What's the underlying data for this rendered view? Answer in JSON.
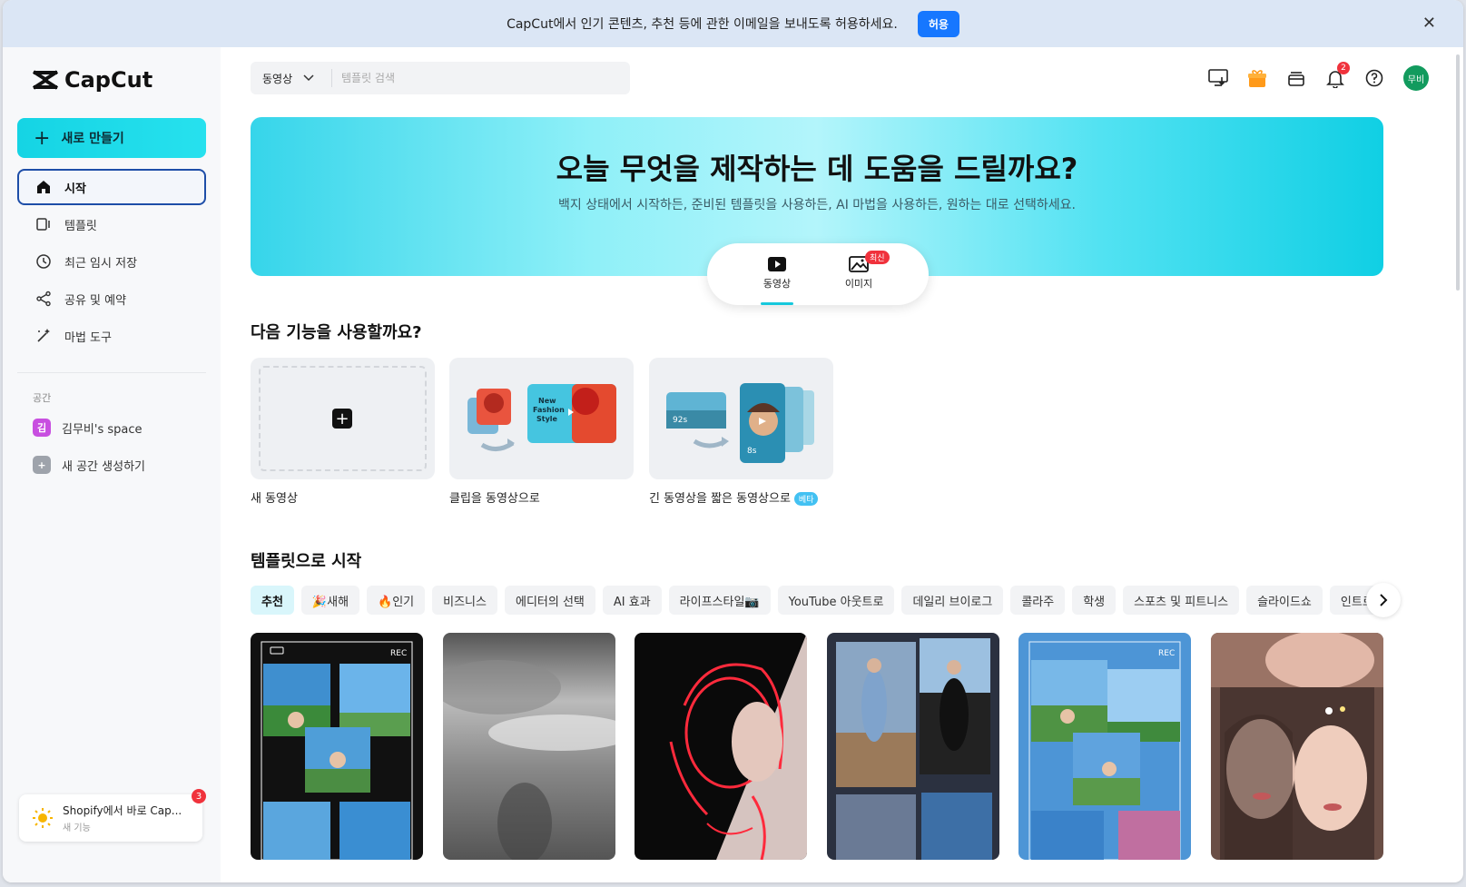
{
  "banner": {
    "message": "CapCut에서 인기 콘텐츠, 추천 등에 관한 이메일을 보내도록 허용하세요.",
    "allow_label": "허용"
  },
  "sidebar": {
    "logo_text": "CapCut",
    "new_button_label": "새로 만들기",
    "items": [
      {
        "label": "시작",
        "icon": "home-icon",
        "active": true
      },
      {
        "label": "템플릿",
        "icon": "template-icon"
      },
      {
        "label": "최근 임시 저장",
        "icon": "clock-icon"
      },
      {
        "label": "공유 및 예약",
        "icon": "share-icon"
      },
      {
        "label": "마법 도구",
        "icon": "magic-wand-icon"
      }
    ],
    "space_label": "공간",
    "spaces": [
      {
        "badge": "김",
        "label": "김무비's space",
        "color": "#c84fe0"
      },
      {
        "badge": "+",
        "label": "새 공간 생성하기",
        "color": "#9ea3ab"
      }
    ],
    "promo": {
      "title": "Shopify에서 바로 Cap...",
      "subtitle": "새 기능",
      "count": "3"
    }
  },
  "topbar": {
    "search_type": "동영상",
    "search_placeholder": "템플릿 검색",
    "notification_count": "2",
    "avatar_text": "무비"
  },
  "hero": {
    "title": "오늘 무엇을 제작하는 데 도움을 드릴까요?",
    "subtitle": "백지 상태에서 시작하든, 준비된 템플릿을 사용하든, AI 마법을 사용하든, 원하는 대로 선택하세요.",
    "tabs": [
      {
        "label": "동영상",
        "active": true
      },
      {
        "label": "이미지",
        "badge": "최신"
      }
    ]
  },
  "features": {
    "title": "다음 기능을 사용할까요?",
    "items": [
      {
        "label": "새 동영상"
      },
      {
        "label": "클립을 동영상으로",
        "thumb_text": "New Fashion Style"
      },
      {
        "label": "긴 동영상을 짧은 동영상으로",
        "badge": "베타",
        "duration_long": "92s",
        "duration_short": "8s"
      }
    ]
  },
  "templates": {
    "title": "템플릿으로 시작",
    "chips": [
      "추천",
      "🎉새해",
      "🔥인기",
      "비즈니스",
      "에디터의 선택",
      "AI 효과",
      "라이프스타일📷",
      "YouTube 아웃트로",
      "데일리 브이로그",
      "콜라주",
      "학생",
      "스포츠 및 피트니스",
      "슬라이드쇼",
      "인트로"
    ],
    "rec_label": "REC"
  },
  "colors": {
    "accent": "#16c8dc",
    "active_border": "#1e4ea8",
    "allow_button": "#1677ff"
  }
}
